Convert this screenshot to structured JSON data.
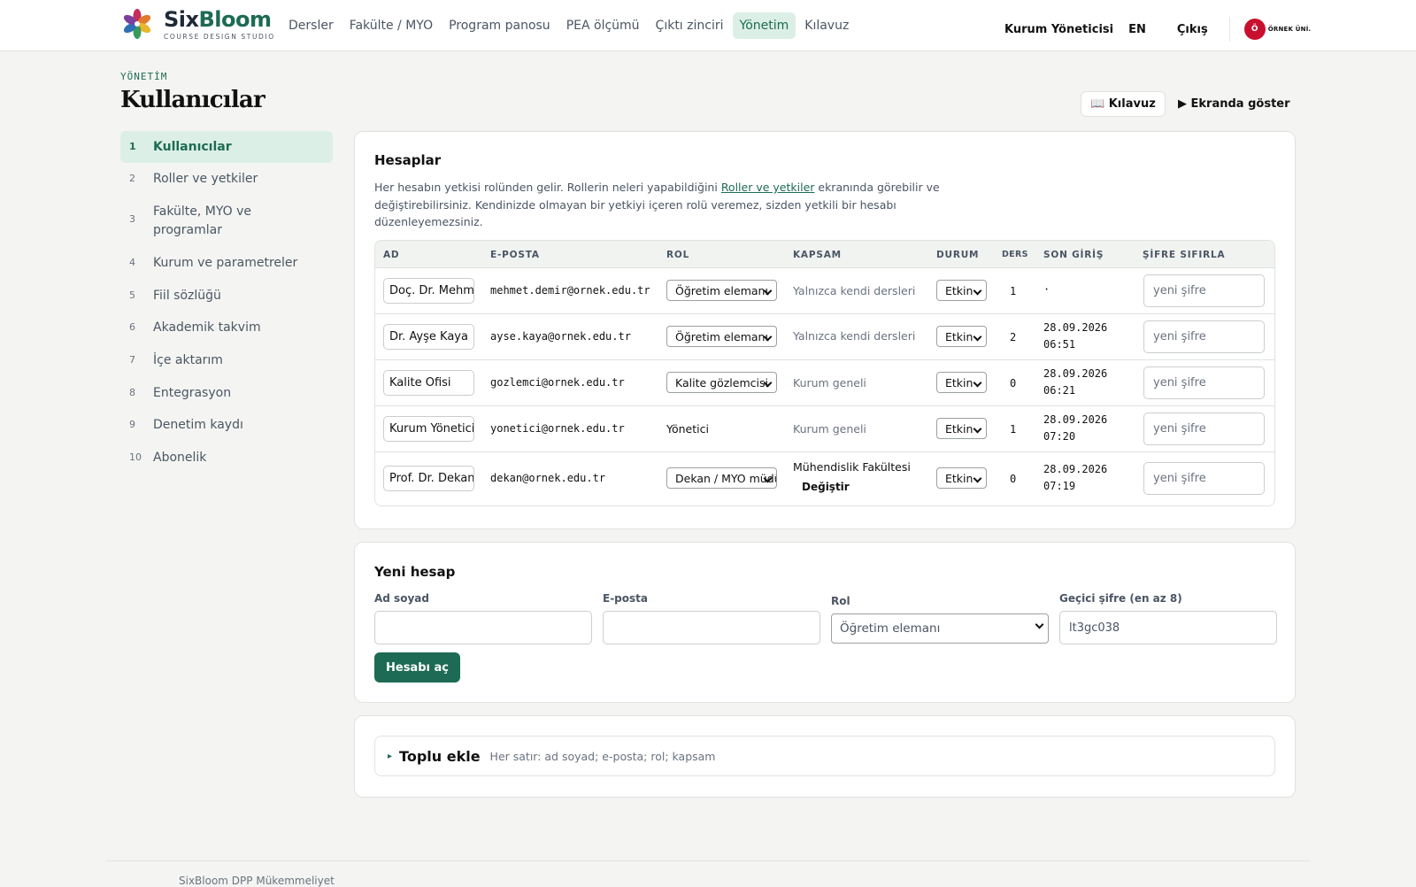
{
  "brand": {
    "name_a": "Six",
    "name_b": "Bloom",
    "subtitle": "COURSE DESIGN STUDIO"
  },
  "nav": [
    {
      "label": "Dersler",
      "active": false
    },
    {
      "label": "Fakülte / MYO",
      "active": false
    },
    {
      "label": "Program panosu",
      "active": false
    },
    {
      "label": "PEA ölçümü",
      "active": false
    },
    {
      "label": "Çıktı zinciri",
      "active": false
    },
    {
      "label": "Yönetim",
      "active": true
    },
    {
      "label": "Kılavuz",
      "active": false
    }
  ],
  "user": {
    "role": "Kurum Yöneticisi",
    "lang": "EN",
    "logout": "Çıkış",
    "org_initial": "Ö",
    "org_name": "ÖRNEK ÜNİ."
  },
  "page": {
    "crumb": "YÖNETİM",
    "title": "Kullanıcılar",
    "guide_button": "📖 Kılavuz",
    "show_button": "▶ Ekranda göster"
  },
  "sidebar": [
    {
      "num": "1",
      "label": "Kullanıcılar",
      "active": true
    },
    {
      "num": "2",
      "label": "Roller ve yetkiler"
    },
    {
      "num": "3",
      "label": "Fakülte, MYO ve programlar"
    },
    {
      "num": "4",
      "label": "Kurum ve parametreler"
    },
    {
      "num": "5",
      "label": "Fiil sözlüğü"
    },
    {
      "num": "6",
      "label": "Akademik takvim"
    },
    {
      "num": "7",
      "label": "İçe aktarım"
    },
    {
      "num": "8",
      "label": "Entegrasyon"
    },
    {
      "num": "9",
      "label": "Denetim kaydı"
    },
    {
      "num": "10",
      "label": "Abonelik"
    }
  ],
  "accounts": {
    "title": "Hesaplar",
    "desc_pre": "Her hesabın yetkisi rolünden gelir. Rollerin neleri yapabildiğini ",
    "desc_link": "Roller ve yetkiler",
    "desc_post": " ekranında görebilir ve değiştirebilirsiniz. Kendinizde olmayan bir yetkiyi içeren rolü veremez, sizden yetkili bir hesabı düzenleyemezsiniz.",
    "headers": {
      "name": "AD",
      "email": "E-POSTA",
      "role": "ROL",
      "scope": "KAPSAM",
      "status": "DURUM",
      "courses": "DERS",
      "last_login": "SON GİRİŞ",
      "reset": "ŞİFRE SIFIRLA"
    },
    "rows": [
      {
        "name": "Doç. Dr. Mehmet Demir",
        "email": "mehmet.demir@ornek.edu.tr",
        "role": "Öğretim elemanı",
        "scope": "Yalnızca kendi dersleri",
        "status": "Etkin",
        "courses": "1",
        "login_date": "·",
        "login_time": "",
        "pw": "yeni şifre"
      },
      {
        "name": "Dr. Ayşe Kaya",
        "email": "ayse.kaya@ornek.edu.tr",
        "role": "Öğretim elemanı",
        "scope": "Yalnızca kendi dersleri",
        "status": "Etkin",
        "courses": "2",
        "login_date": "28.09.2026",
        "login_time": "06:51",
        "pw": "yeni şifre"
      },
      {
        "name": "Kalite Ofisi",
        "email": "gozlemci@ornek.edu.tr",
        "role": "Kalite gözlemcisi",
        "scope": "Kurum geneli",
        "status": "Etkin",
        "courses": "0",
        "login_date": "28.09.2026",
        "login_time": "06:21",
        "pw": "yeni şifre"
      },
      {
        "name": "Kurum Yöneticisi",
        "email": "yonetici@ornek.edu.tr",
        "role": "Yönetici",
        "scope": "Kurum geneli",
        "status": "Etkin",
        "courses": "1",
        "login_date": "28.09.2026",
        "login_time": "07:20",
        "pw": "yeni şifre"
      },
      {
        "name": "Prof. Dr. Dekan",
        "email": "dekan@ornek.edu.tr",
        "role": "Dekan / MYO müdürü",
        "scope": "Mühendislik Fakültesi",
        "scope_action": "Değiştir",
        "status": "Etkin",
        "courses": "0",
        "login_date": "28.09.2026",
        "login_time": "07:19",
        "pw": "yeni şifre"
      }
    ]
  },
  "new_account": {
    "title": "Yeni hesap",
    "name_label": "Ad soyad",
    "name_value": "",
    "email_label": "E-posta",
    "email_value": "",
    "role_label": "Rol",
    "role_value": "Öğretim elemanı",
    "pw_label": "Geçici şifre (en az 8)",
    "pw_value": "lt3gc038",
    "submit": "Hesabı aç"
  },
  "bulk": {
    "arrow": "▸",
    "title": "Toplu ekle",
    "hint": "Her satır: ad soyad; e-posta; rol; kapsam"
  },
  "footer": {
    "text": "SixBloom DPP Mükemmeliyet"
  }
}
